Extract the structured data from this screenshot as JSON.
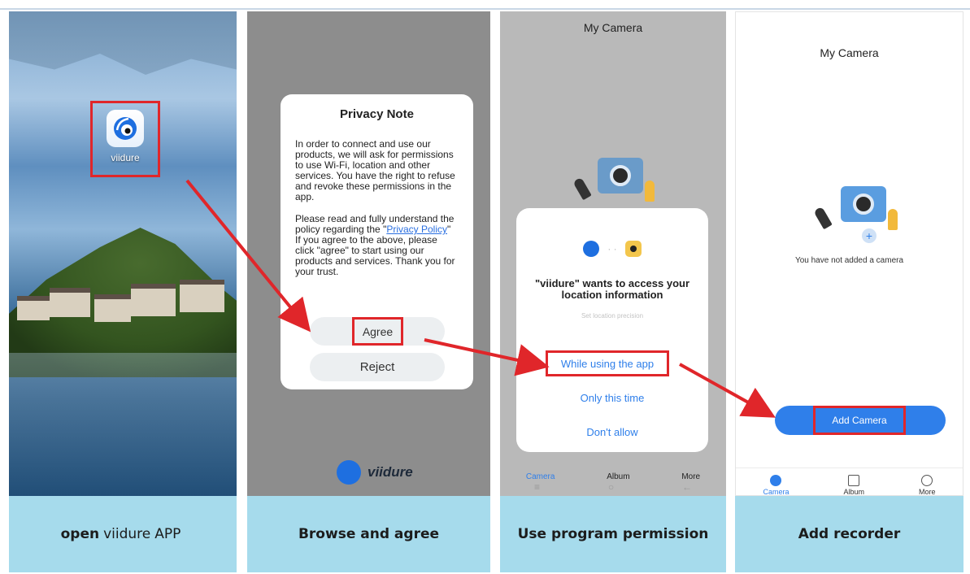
{
  "panels": [
    {
      "caption_bold_start": "open",
      "caption_light": "viidure",
      "caption_bold_end": "APP",
      "app_icon_label": "viidure"
    },
    {
      "caption": "Browse and agree",
      "dialog": {
        "title": "Privacy Note",
        "para1": "In order to connect and use our products, we will ask for permissions to use Wi-Fi, location and other services. You have the right to refuse and revoke these permissions in the app.",
        "para2_before_link": "Please read and fully understand the policy regarding the \"",
        "link_text": "Privacy Policy",
        "para2_after_link": "\" If you agree to the above, please click \"agree\" to start using our products and services. Thank you for your trust.",
        "agree_label": "Agree",
        "reject_label": "Reject"
      },
      "brand_text": "viidure"
    },
    {
      "caption": "Use program permission",
      "title": "My Camera",
      "dialog": {
        "title": "\"viidure\" wants to access your location information",
        "subtitle": "Set location precision",
        "option_while": "While using the app",
        "option_once": "Only this time",
        "option_deny": "Don't allow"
      },
      "tabs": [
        "Camera",
        "Album",
        "More"
      ]
    },
    {
      "caption": "Add recorder",
      "title": "My Camera",
      "empty_text": "You have not added a camera",
      "add_button": "Add Camera",
      "tabs": [
        "Camera",
        "Album",
        "More"
      ]
    }
  ],
  "colors": {
    "highlight": "#e0262a",
    "accent": "#2f7fea",
    "caption_bg": "#a6dbec"
  }
}
